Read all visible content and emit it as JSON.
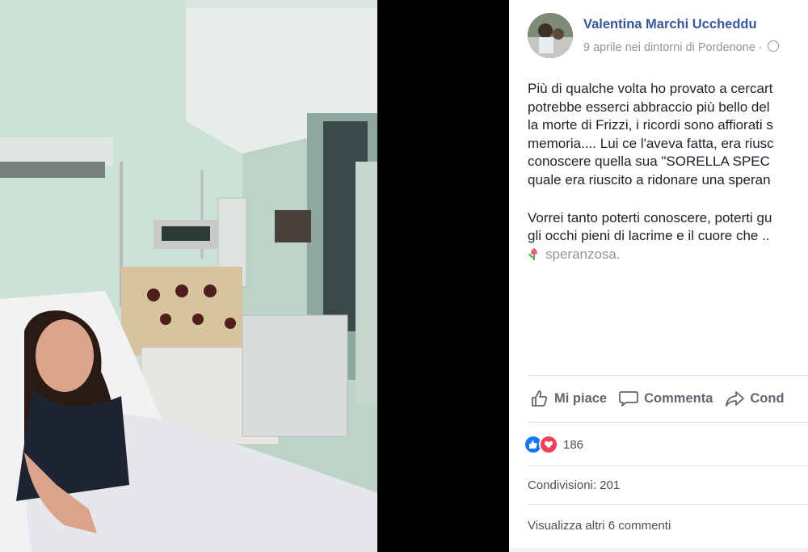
{
  "post": {
    "author": "Valentina Marchi Uccheddu",
    "meta": "9 aprile nei dintorni di Pordenone ·",
    "privacy_icon": "globe-icon",
    "avatar_icon": "profile-photo",
    "body_lines": [
      "Più di qualche volta ho provato a cercart",
      "potrebbe esserci abbraccio più bello del",
      "la morte di Frizzi, i ricordi sono affiorati s",
      "memoria.... Lui ce l'aveva fatta, era riusc",
      "conoscere quella sua \"SORELLA SPEC",
      "quale era riuscito a ridonare una speran"
    ],
    "body_lines_2": [
      "Vorrei tanto poterti conoscere, poterti gu",
      "gli occhi pieni di lacrime e il cuore che .."
    ],
    "feeling": "speranzosa.",
    "feeling_icon": "tulip-icon"
  },
  "actions": {
    "like_label": "Mi piace",
    "comment_label": "Commenta",
    "share_label": "Cond",
    "like_icon": "thumbs-up-icon",
    "comment_icon": "comment-icon",
    "share_icon": "share-arrow-icon"
  },
  "stats": {
    "reactions_count": "186",
    "reaction_icons": [
      "like-reaction-icon",
      "love-reaction-icon"
    ],
    "shares": "Condivisioni: 201",
    "more_comments": "Visualizza altri 6 commenti"
  },
  "colors": {
    "author": "#365899",
    "meta": "#90949c",
    "body": "#1d2129",
    "like_blue": "#1877f2",
    "love_red": "#f33e58",
    "wall_green": "#cfe3d8"
  }
}
